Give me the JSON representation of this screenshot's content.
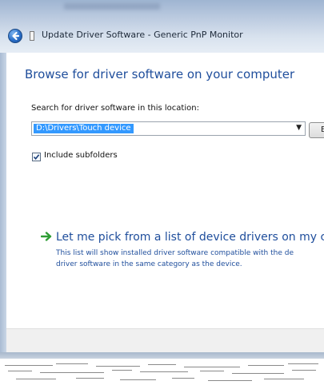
{
  "window": {
    "title": "Update Driver Software - Generic PnP Monitor"
  },
  "main": {
    "heading": "Browse for driver software on your computer",
    "search_label": "Search for driver software in this location:",
    "search_path": "D:\\Drivers\\Touch device",
    "browse_label": "B",
    "include_subfolders_label": "Include subfolders",
    "include_subfolders_checked": true,
    "pick_link": "Let me pick from a list of device drivers on my cor",
    "pick_desc_line1": "This list will show installed driver software compatible with the de",
    "pick_desc_line2": "driver software in the same category as the device."
  },
  "colors": {
    "heading": "#1f4e9c",
    "selection": "#3399ff",
    "arrow": "#2e9d34"
  },
  "icons": {
    "back": "back-arrow-icon",
    "device": "device-icon",
    "dropdown": "chevron-down-icon",
    "checkbox": "checkmark-icon",
    "link_arrow": "green-arrow-icon"
  }
}
